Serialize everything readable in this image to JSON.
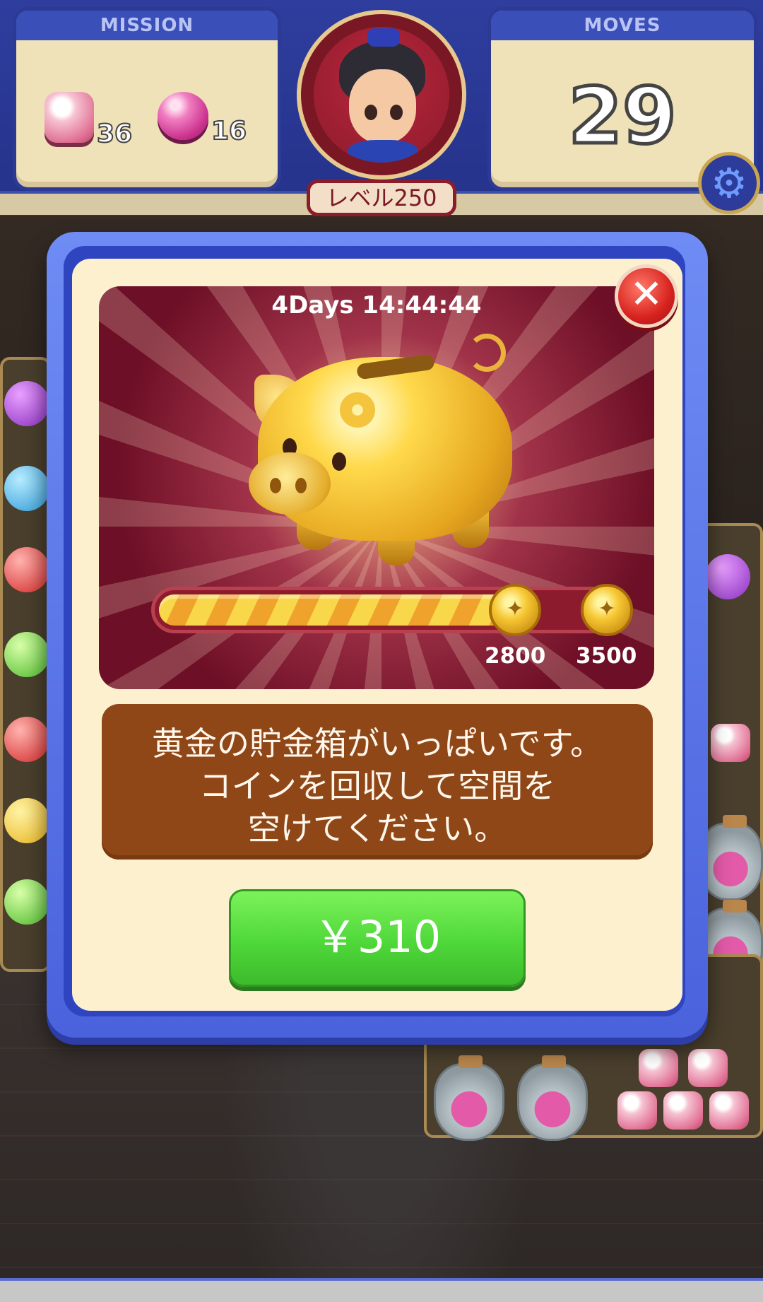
{
  "hud": {
    "mission_label": "MISSION",
    "moves_label": "MOVES",
    "moves_value": "29",
    "mission_items": [
      {
        "icon": "marshmallow-candy-icon",
        "count": "36"
      },
      {
        "icon": "lollipop-candy-icon",
        "count": "16"
      }
    ],
    "level_label": "レベル250",
    "settings_icon": "gear-icon"
  },
  "offer": {
    "timer": "4Days 14:44:44",
    "close_icon": "close-icon",
    "progress_fraction": 0.77,
    "milestones": [
      "2800",
      "3500"
    ],
    "message_lines": [
      "黄金の貯金箱がいっぱいです。",
      "コインを回収して空間を",
      "空けてください。"
    ],
    "price": "￥310"
  },
  "colors": {
    "hud_blue": "#2f3d9e",
    "dialog_blue": "#4a62dc",
    "hero_maroon": "#6d0f26",
    "message_brown": "#8f4717",
    "buy_green": "#4fd83a",
    "close_red": "#d7231f",
    "coin_gold": "#f6c733"
  }
}
